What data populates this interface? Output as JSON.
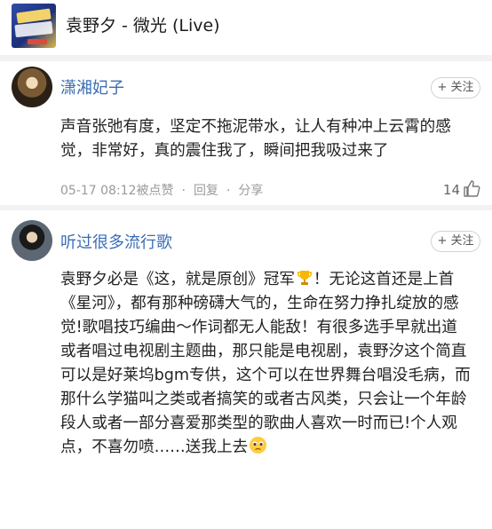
{
  "song": {
    "title": "袁野夕 - 微光 (Live)"
  },
  "comments": [
    {
      "username": "潇湘妃子",
      "follow_label": "+ 关注",
      "text": "声音张弛有度，坚定不拖泥带水，让人有种冲上云霄的感觉，非常好，真的震住我了，瞬间把我吸过来了",
      "timestamp": "05-17 08:12",
      "liked_label": "被点赞",
      "reply_label": "回复",
      "share_label": "分享",
      "separator": "·",
      "like_count": "14"
    },
    {
      "username": "听过很多流行歌",
      "follow_label": "+ 关注",
      "text": "袁野夕必是《这，就是原创》冠军",
      "text_mid": "！无论这首还是上首《星河》，都有那种磅礴大气的，生命在努力挣扎绽放的感觉!歌唱技巧编曲～作词都无人能敌！有很多选手早就出道或者唱过电视剧主题曲，那只能是电视剧，袁野汐这个简直可以是好莱坞bgm专供，这个可以在世界舞台唱没毛病，而那什么学猫叫之类或者搞笑的或者古风类，只会让一个年龄段人或者一部分喜爱那类型的歌曲人喜欢一时而已!个人观点，不喜勿喷……送我上去",
      "trophy_icon": "trophy-icon",
      "emoji_icon": "pleading-face-icon"
    }
  ],
  "colors": {
    "username": "#3a6db5",
    "meta": "#9a9a9a",
    "divider": "#f2f2f2"
  }
}
